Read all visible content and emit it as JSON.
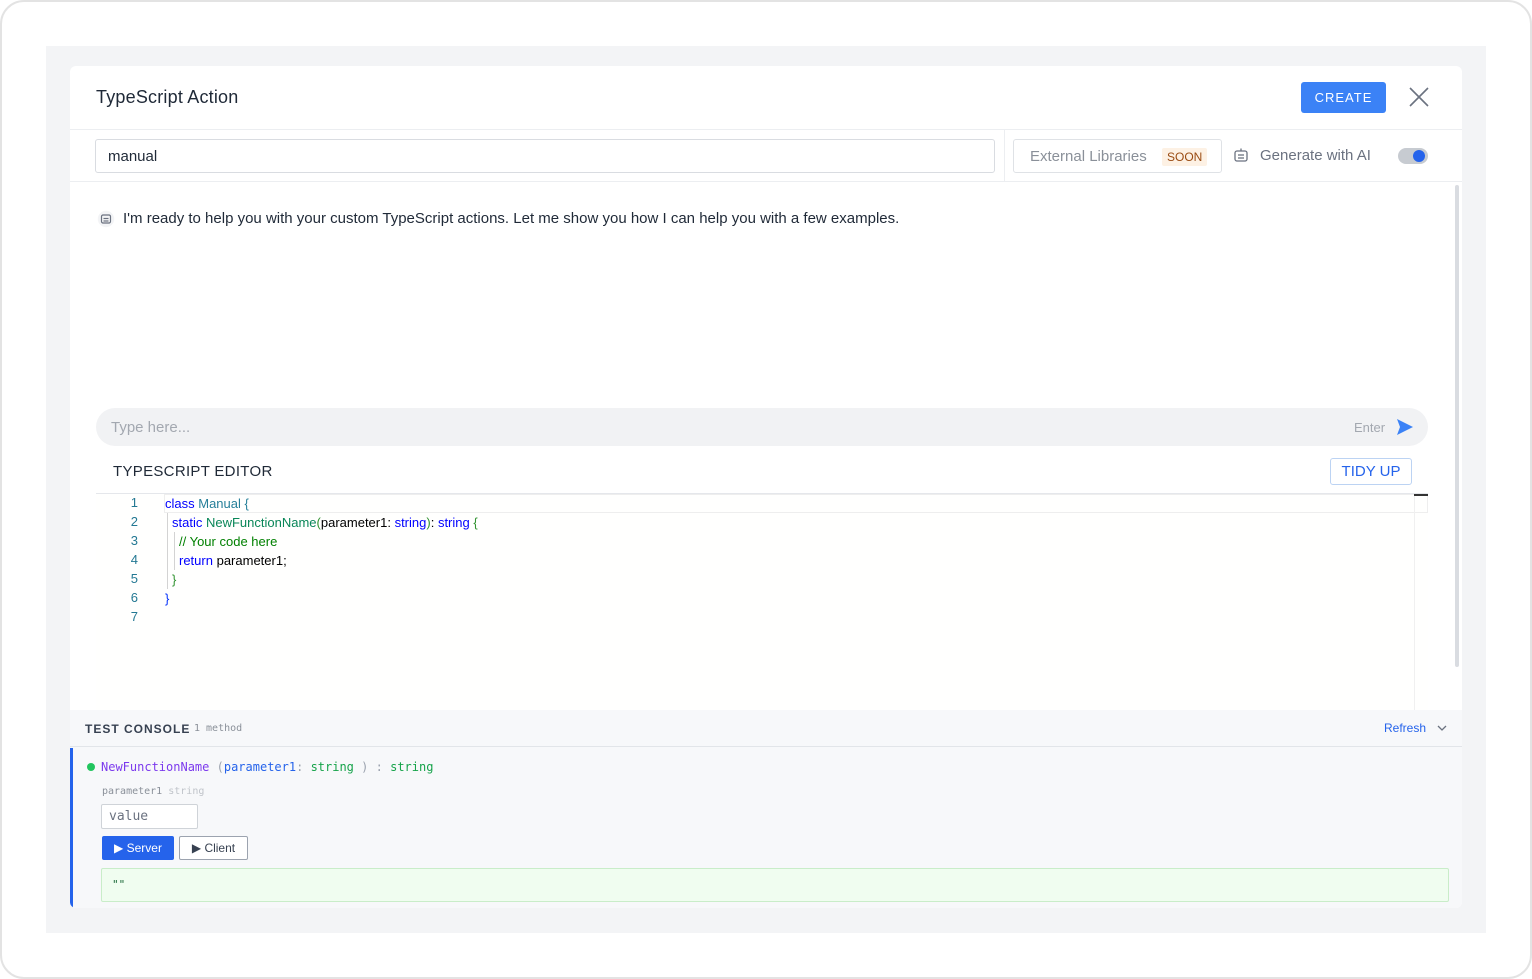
{
  "modal": {
    "title": "TypeScript Action",
    "create_label": "CREATE"
  },
  "toolbar": {
    "name_value": "manual",
    "external_libraries_label": "External Libraries",
    "soon_badge": "SOON",
    "generate_ai_label": "Generate with AI",
    "generate_ai_enabled": true
  },
  "ai_chat": {
    "message": "I'm ready to help you with your custom TypeScript actions. Let me show you how I can help you with a few examples.",
    "input_placeholder": "Type here...",
    "enter_hint": "Enter"
  },
  "editor": {
    "title": "TYPESCRIPT EDITOR",
    "tidy_label": "TIDY UP",
    "line_numbers": [
      "1",
      "2",
      "3",
      "4",
      "5",
      "6",
      "7"
    ],
    "tokens": {
      "l1_kw": "class",
      "l1_cls": "Manual",
      "l1_brace": "{",
      "l2_kw": "static",
      "l2_fn": "NewFunctionName",
      "l2_open": "(",
      "l2_param": "parameter1: ",
      "l2_type": "string",
      "l2_close": ")",
      "l2_colon": ": ",
      "l2_ret": "string",
      "l2_brace": "{",
      "l3_comment": "// Your code here",
      "l4_kw": "return",
      "l4_rest": "parameter1;",
      "l5_brace": "}",
      "l6_brace": "}"
    }
  },
  "console": {
    "title": "TEST CONSOLE",
    "count": "1 method",
    "refresh_label": "Refresh",
    "method": {
      "name": "NewFunctionName",
      "open": "(",
      "param": "parameter1",
      "sep": ":",
      "param_type": "string",
      "close": ")",
      "ret_sep": ":",
      "return_type": "string",
      "param_label": "parameter1",
      "param_label_type": "string",
      "param_placeholder": "value",
      "server_label": "Server",
      "client_label": "Client",
      "result": "\"\""
    }
  },
  "colors": {
    "primary": "#3b82f6",
    "accent": "#2563eb",
    "status_ok": "#22c55e"
  }
}
